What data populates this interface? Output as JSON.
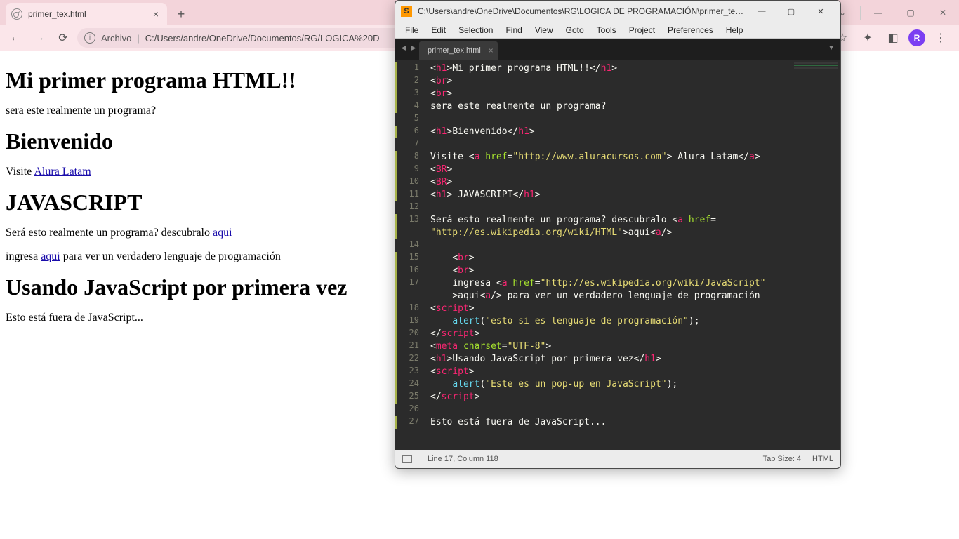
{
  "chrome": {
    "tab_title": "primer_tex.html",
    "address_label": "Archivo",
    "address_url": "C:/Users/andre/OneDrive/Documentos/RG/LOGICA%20D",
    "avatar_letter": "R"
  },
  "page_content": {
    "h1_1": "Mi primer programa HTML!!",
    "p1": "sera este realmente un programa?",
    "h1_2": "Bienvenido",
    "p2_pre": "Visite ",
    "p2_link": "Alura Latam",
    "h1_3": "JAVASCRIPT",
    "p3_pre": "Será esto realmente un programa? descubralo ",
    "p3_link": "aqui",
    "p4_pre": "ingresa ",
    "p4_link": "aqui",
    "p4_post": " para ver un verdadero lenguaje de programación",
    "h1_4": "Usando JavaScript por primera vez",
    "p5": "Esto está fuera de JavaScript..."
  },
  "sublime": {
    "title": "C:\\Users\\andre\\OneDrive\\Documentos\\RG\\LOGICA DE PROGRAMACIÓN\\primer_tex.ht...",
    "tab": "primer_tex.html",
    "menu": [
      "File",
      "Edit",
      "Selection",
      "Find",
      "View",
      "Goto",
      "Tools",
      "Project",
      "Preferences",
      "Help"
    ],
    "menu_u": [
      "F",
      "E",
      "S",
      "i",
      "V",
      "G",
      "T",
      "P",
      "r",
      "H"
    ],
    "status_pos": "Line 17, Column 118",
    "status_tab": "Tab Size: 4",
    "status_lang": "HTML",
    "lines": [
      {
        "n": 1,
        "mod": true
      },
      {
        "n": 2,
        "mod": true
      },
      {
        "n": 3,
        "mod": true
      },
      {
        "n": 4,
        "mod": true
      },
      {
        "n": 5,
        "mod": false
      },
      {
        "n": 6,
        "mod": true
      },
      {
        "n": 7,
        "mod": false
      },
      {
        "n": 8,
        "mod": true
      },
      {
        "n": 9,
        "mod": true
      },
      {
        "n": 10,
        "mod": true
      },
      {
        "n": 11,
        "mod": true
      },
      {
        "n": 12,
        "mod": false
      },
      {
        "n": 13,
        "mod": true
      },
      {
        "n": "",
        "mod": true
      },
      {
        "n": 14,
        "mod": false
      },
      {
        "n": 15,
        "mod": true
      },
      {
        "n": 16,
        "mod": true
      },
      {
        "n": 17,
        "mod": true
      },
      {
        "n": "",
        "mod": true
      },
      {
        "n": 18,
        "mod": true
      },
      {
        "n": 19,
        "mod": true
      },
      {
        "n": 20,
        "mod": true
      },
      {
        "n": 21,
        "mod": true
      },
      {
        "n": 22,
        "mod": true
      },
      {
        "n": 23,
        "mod": true
      },
      {
        "n": 24,
        "mod": true
      },
      {
        "n": 25,
        "mod": true
      },
      {
        "n": 26,
        "mod": false
      },
      {
        "n": 27,
        "mod": true
      }
    ],
    "code": {
      "l1": {
        "t1": "h1",
        "tx": "Mi primer programa HTML!!",
        "t2": "h1"
      },
      "l2": {
        "t": "br"
      },
      "l3": {
        "t": "br"
      },
      "l4": {
        "tx": "sera este realmente un programa?"
      },
      "l6": {
        "t1": "h1",
        "tx": "Bienvenido",
        "t2": "h1"
      },
      "l8": {
        "pre": "Visite ",
        "t": "a",
        "attr": "href",
        "val": "\"http://www.aluracursos.com\"",
        "tx": " Alura Latam",
        "t2": "a"
      },
      "l9": {
        "t": "BR"
      },
      "l10": {
        "t": "BR"
      },
      "l11": {
        "t1": "h1",
        "tx": " JAVASCRIPT",
        "t2": "h1"
      },
      "l13": {
        "pre": "Será esto realmente un programa? descubralo ",
        "t": "a",
        "attr": "href",
        "eq": "="
      },
      "l13b": {
        "val": "\"http://es.wikipedia.org/wiki/HTML\"",
        "tx": "aqui",
        "t2": "a"
      },
      "l15": {
        "t": "br"
      },
      "l16": {
        "t": "br"
      },
      "l17": {
        "pre": "ingresa ",
        "t": "a",
        "attr": "href",
        "val": "\"http://es.wikipedia.org/wiki/JavaScript\""
      },
      "l17b": {
        "tx": "aqui",
        "t2": "a",
        "post": " para ver un verdadero lenguaje de programación"
      },
      "l18": {
        "t": "script"
      },
      "l19": {
        "fn": "alert",
        "arg": "\"esto si es lenguaje de programación\"",
        "sc": ";"
      },
      "l20": {
        "t": "script"
      },
      "l21": {
        "t": "meta",
        "attr": "charset",
        "val": "\"UTF-8\""
      },
      "l22": {
        "t1": "h1",
        "tx": "Usando JavaScript por primera vez",
        "t2": "h1"
      },
      "l23": {
        "t": "script"
      },
      "l24": {
        "fn": "alert",
        "arg": "\"Este es un pop-up en JavaScript\"",
        "sc": ";"
      },
      "l25": {
        "t": "script"
      },
      "l27": {
        "tx": "Esto está fuera de JavaScript..."
      }
    }
  }
}
